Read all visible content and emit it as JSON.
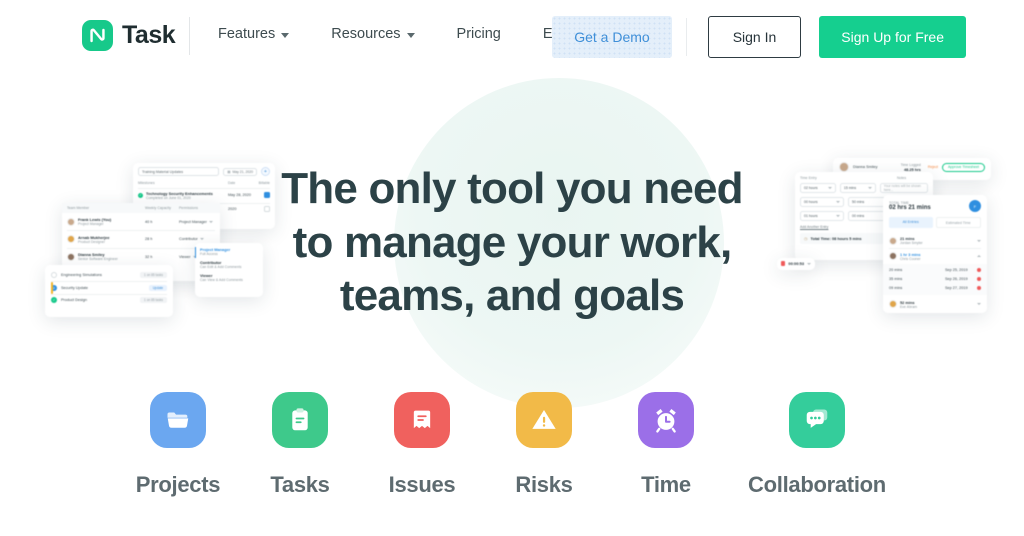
{
  "header": {
    "logo_text": "Task",
    "logo_icon": "ntask-logo-icon",
    "nav": [
      {
        "label": "Features",
        "has_caret": true
      },
      {
        "label": "Resources",
        "has_caret": true
      },
      {
        "label": "Pricing",
        "has_caret": false
      },
      {
        "label": "Enterprise",
        "has_caret": false
      }
    ],
    "demo_button": "Get a Demo",
    "signin_button": "Sign In",
    "signup_button": "Sign Up for Free"
  },
  "hero": {
    "headline_lines": [
      "The only tool you need",
      "to manage your work,",
      "teams, and goals"
    ]
  },
  "left_mockup": {
    "task_title": "Training Material Updates",
    "date_pill": "May 21, 2020",
    "add_icon": "plus-circle-icon",
    "columns": {
      "milestones": "Milestones",
      "date": "Date",
      "billable": "Billable"
    },
    "milestone": {
      "name": "Technology Security Enhancements",
      "sub": "Completed on June 01, 2020",
      "date": "May 28, 2020"
    },
    "milestone2_date": "2020",
    "team_columns": {
      "member": "Team Member",
      "capacity": "Weekly Capacity",
      "permissions": "Permissions"
    },
    "team": [
      {
        "name": "Frank Lewis (You)",
        "role": "Project Manager",
        "capacity": "40 h",
        "permission": "Project Manager"
      },
      {
        "name": "Arnab Mukherjee",
        "role": "Product Designer",
        "capacity": "28 h",
        "permission": "Contributor"
      },
      {
        "name": "Dianna Smiley",
        "role": "Senior Software Engineer",
        "capacity": "32 h",
        "permission": "Viewer"
      }
    ],
    "permission_menu": [
      {
        "title": "Project Manager",
        "desc": "Full Access",
        "selected": true
      },
      {
        "title": "Contributor",
        "desc": "Can Edit & Add Comments",
        "selected": false
      },
      {
        "title": "Viewer",
        "desc": "Can View & Add Comments",
        "selected": false
      }
    ],
    "projects": [
      {
        "name": "Engineering Simulations",
        "tag": "1 on 85 tasks",
        "state": "empty"
      },
      {
        "name": "Security Update",
        "tag": "Update",
        "state": "badge"
      },
      {
        "name": "Product Design",
        "tag": "1 on 85 tasks",
        "state": "done"
      }
    ]
  },
  "right_mockup": {
    "user_name": "Dianna Smiley",
    "time_logged_label": "Time Logged",
    "time_logged_value": "48.25 hrs",
    "reject_label": "Reject",
    "approve_label": "Approve Timesheet",
    "time_entry_label": "Time Entry",
    "notes_label": "Notes",
    "notes_placeholder": "Your notes will be shown here...",
    "entries": [
      {
        "hours": "02 hours",
        "mins": "15 mins"
      },
      {
        "hours": "00 hours",
        "mins": "50 mins"
      },
      {
        "hours": "01 hours",
        "mins": "00 mins"
      }
    ],
    "add_entry_link": "Add Another Entry",
    "total_time_row": "Total Time: 08 hours 5 mins",
    "timer_value": "00:00:53",
    "total_time_label": "TOTAL TIME",
    "total_time_value": "02 hrs 21 mins",
    "avatar_initial": "F",
    "tabs": [
      {
        "label": "All Entries",
        "active": true
      },
      {
        "label": "Estimated Time",
        "active": false
      }
    ],
    "log_entries": [
      {
        "duration": "21 mins",
        "person": "Jordan Smyter"
      },
      {
        "duration": "1 hr 3 mins",
        "person": "Chris Cooner"
      },
      {
        "duration": "52 mins",
        "person": "Eve Abram"
      }
    ],
    "sub_entries": [
      {
        "duration": "20 mins",
        "date": "Sep 25, 2019"
      },
      {
        "duration": "35 mins",
        "date": "Sep 26, 2019"
      },
      {
        "duration": "09 mins",
        "date": "Sep 27, 2019"
      }
    ]
  },
  "features": [
    {
      "label": "Projects",
      "icon": "folder-icon",
      "color": "#6BA7F0"
    },
    {
      "label": "Tasks",
      "icon": "clipboard-icon",
      "color": "#3EC98B"
    },
    {
      "label": "Issues",
      "icon": "bookmark-icon",
      "color": "#F0615E"
    },
    {
      "label": "Risks",
      "icon": "warning-icon",
      "color": "#F2BA48"
    },
    {
      "label": "Time",
      "icon": "alarm-icon",
      "color": "#9B6FE8"
    },
    {
      "label": "Collaboration",
      "icon": "chat-icon",
      "color": "#34CD9B"
    }
  ],
  "colors": {
    "brand_green": "#15cf8f",
    "headline": "#2c4247",
    "mint_circle": "#edf7f4",
    "demo_blue": "#3f8fd8"
  }
}
